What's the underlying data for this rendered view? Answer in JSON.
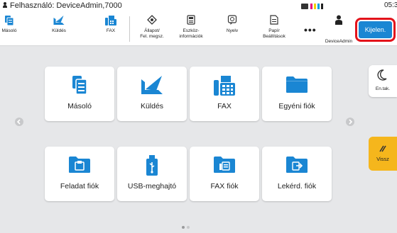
{
  "status_bar": {
    "user_text": "Felhasználó: DeviceAdmin,7000",
    "clock": "05:3",
    "toner_colors": [
      "#e5007d",
      "#f5d000",
      "#00a0e0",
      "#222222"
    ]
  },
  "toolbar": {
    "items": [
      {
        "label": "Másoló",
        "icon": "copier-icon"
      },
      {
        "label": "Küldés",
        "icon": "send-icon"
      },
      {
        "label": "FAX",
        "icon": "fax-icon"
      },
      {
        "label": "Állapot/\nFel. megsz.",
        "icon": "status-icon"
      },
      {
        "label": "Eszköz-\ninformációk",
        "icon": "device-info-icon"
      },
      {
        "label": "Nyelv",
        "icon": "language-icon"
      },
      {
        "label": "Papír\nBeállítások",
        "icon": "paper-settings-icon"
      }
    ],
    "more": "•••",
    "account_label": "DeviceAdmin",
    "logout_label": "Kijelen."
  },
  "home_tiles": [
    {
      "label": "Másoló",
      "icon": "copier-icon"
    },
    {
      "label": "Küldés",
      "icon": "send-icon"
    },
    {
      "label": "FAX",
      "icon": "fax-icon"
    },
    {
      "label": "Egyéni fiók",
      "icon": "custom-box-folder-icon"
    },
    {
      "label": "Feladat fiók",
      "icon": "job-box-folder-icon"
    },
    {
      "label": "USB-meghajtó",
      "icon": "usb-drive-icon"
    },
    {
      "label": "FAX fiók",
      "icon": "fax-box-folder-icon"
    },
    {
      "label": "Lekérd. fiók",
      "icon": "polling-box-folder-icon"
    }
  ],
  "side_buttons": {
    "energy_saver": "En.tak.",
    "back": "Vissz"
  },
  "pagination": {
    "pages": 2,
    "current": 1
  },
  "colors": {
    "accent": "#1a86d3",
    "logout_highlight": "#e3131b",
    "back_button": "#f5b61c",
    "background": "#e6e7e9"
  }
}
